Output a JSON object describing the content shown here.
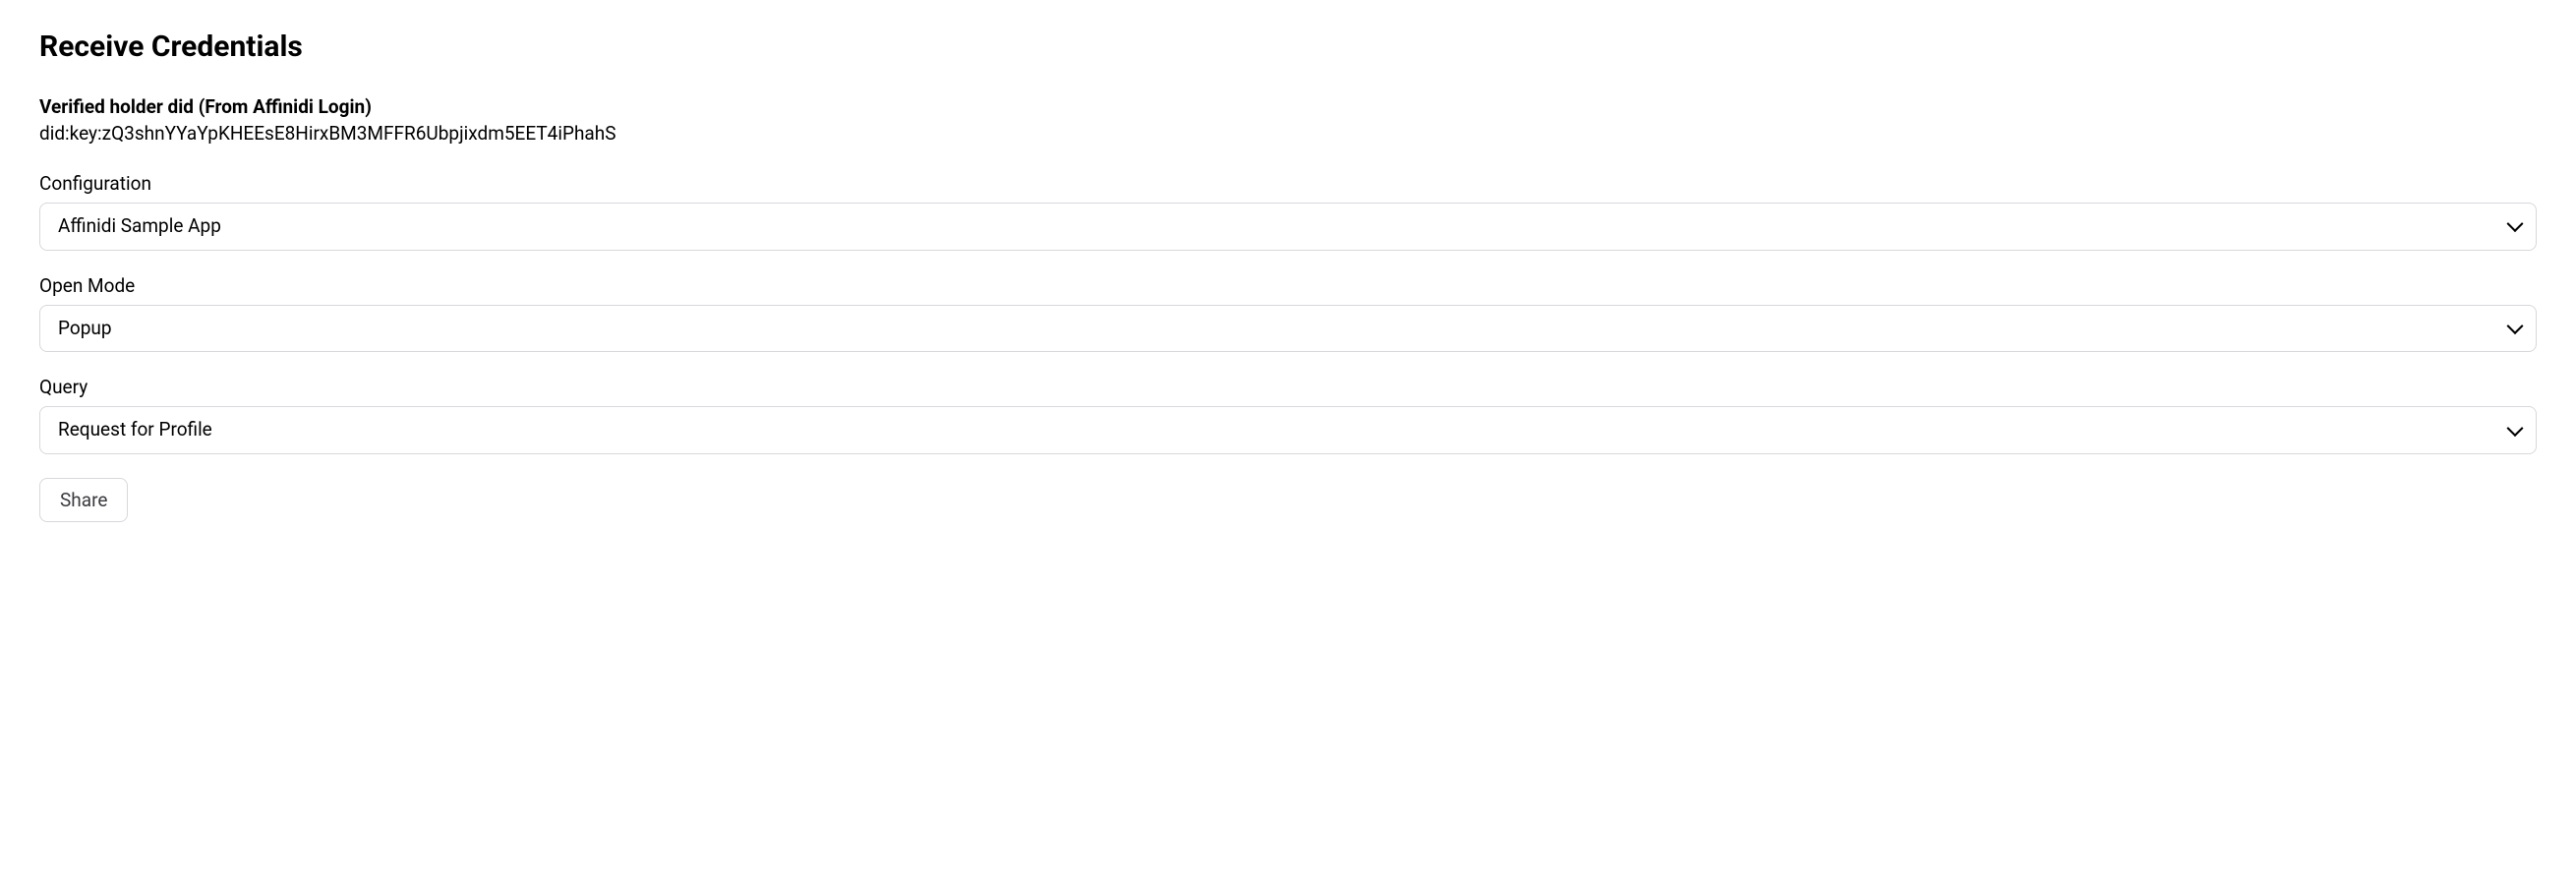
{
  "page": {
    "title": "Receive Credentials"
  },
  "holder": {
    "label": "Verified holder did (From Affinidi Login)",
    "value": "did:key:zQ3shnYYaYpKHEEsE8HirxBM3MFFR6Ubpjixdm5EET4iPhahS"
  },
  "fields": {
    "configuration": {
      "label": "Configuration",
      "selected": "Affinidi Sample App"
    },
    "openMode": {
      "label": "Open Mode",
      "selected": "Popup"
    },
    "query": {
      "label": "Query",
      "selected": "Request for Profile"
    }
  },
  "actions": {
    "share": "Share"
  }
}
